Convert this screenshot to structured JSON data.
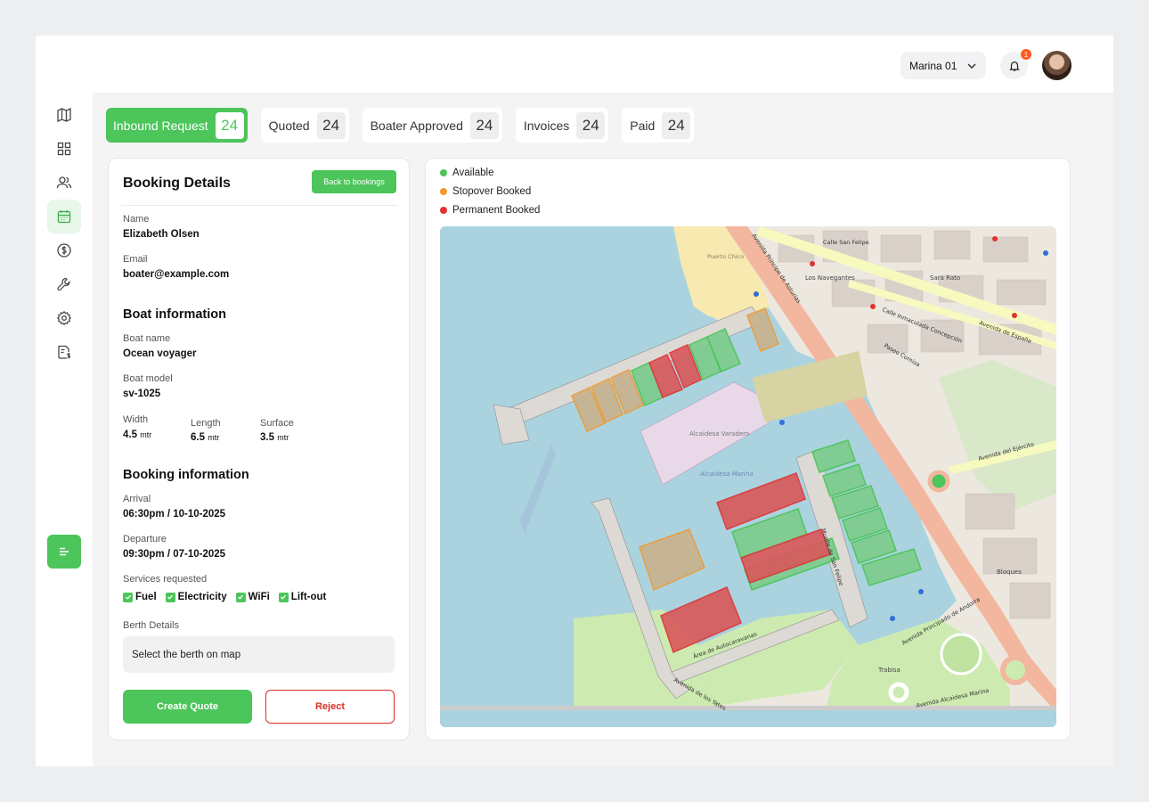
{
  "header": {
    "marina": "Marina 01",
    "notifications": "1"
  },
  "tabs": [
    {
      "label": "Inbound Request",
      "count": "24"
    },
    {
      "label": "Quoted",
      "count": "24"
    },
    {
      "label": "Boater Approved",
      "count": "24"
    },
    {
      "label": "Invoices",
      "count": "24"
    },
    {
      "label": "Paid",
      "count": "24"
    }
  ],
  "details": {
    "title": "Booking Details",
    "back_label": "Back to bookings",
    "name_label": "Name",
    "name": "Elizabeth Olsen",
    "email_label": "Email",
    "email": "boater@example.com",
    "boat_section": "Boat information",
    "boat_name_label": "Boat name",
    "boat_name": "Ocean voyager",
    "boat_model_label": "Boat model",
    "boat_model": "sv-1025",
    "width_label": "Width",
    "width": "4.5",
    "length_label": "Length",
    "length": "6.5",
    "surface_label": "Surface",
    "surface": "3.5",
    "unit": "mtr",
    "booking_section": "Booking information",
    "arrival_label": "Arrival",
    "arrival": "06:30pm / 10-10-2025",
    "departure_label": "Departure",
    "departure": "09:30pm / 07-10-2025",
    "services_label": "Services requested",
    "services": [
      "Fuel",
      "Electricity",
      "WiFi",
      "Lift-out"
    ],
    "berth_label": "Berth Details",
    "berth_placeholder": "Select the berth on map",
    "create_label": "Create Quote",
    "reject_label": "Reject"
  },
  "legend": [
    {
      "label": "Available",
      "color": "#4cc55a"
    },
    {
      "label": "Stopover Booked",
      "color": "#f2992e"
    },
    {
      "label": "Permanent Booked",
      "color": "#e03131"
    }
  ],
  "map": {
    "streets": [
      "Avenida Príncipe de Asturias",
      "Puerto Chico",
      "Alcaidesa Varadero",
      "Alcaidesa Marina",
      "Calle Inmaculada Concepción",
      "Avenida de España",
      "Paseo Cornisa",
      "Avenida del Ejército",
      "Muelle de San Felipe",
      "Avenida de los Yates",
      "Área de Autocaravanas",
      "Avenida Alcaidesa Marina",
      "Avenida Principado de Andorra",
      "Calle San Felipe",
      "Los Navegantes",
      "Sara Rato",
      "Bloques",
      "Trabisa"
    ]
  }
}
